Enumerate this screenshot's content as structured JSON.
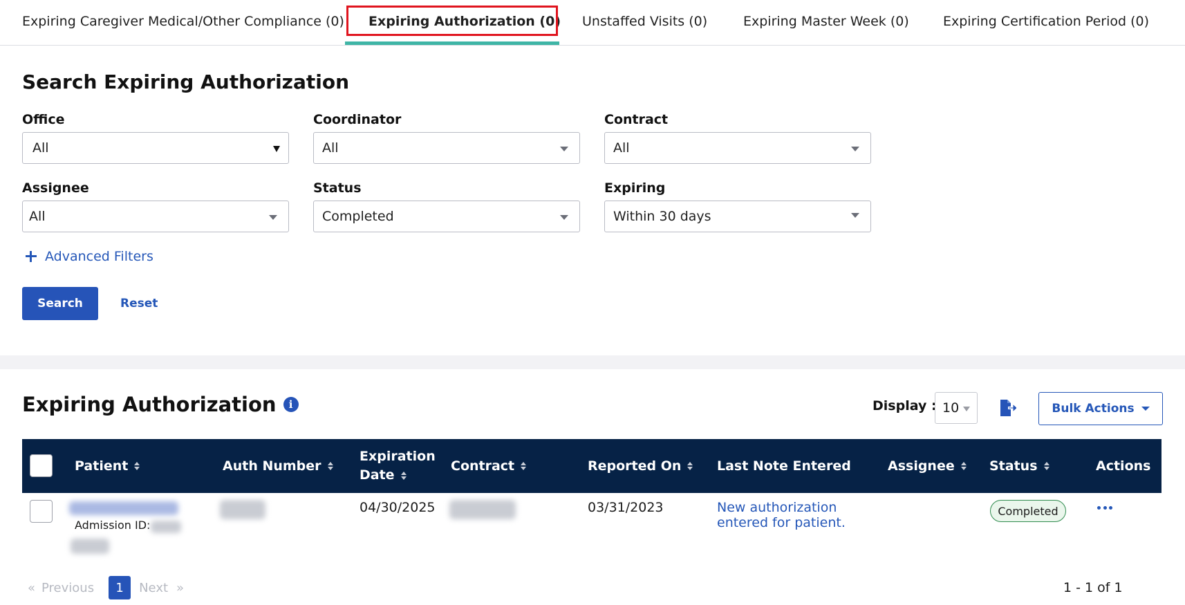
{
  "tabs": [
    {
      "label": "Expiring Caregiver Medical/Other Compliance (0)",
      "active": false
    },
    {
      "label": "Expiring Authorization (0)",
      "active": true
    },
    {
      "label": "Unstaffed Visits (0)",
      "active": false
    },
    {
      "label": "Expiring Master Week (0)",
      "active": false
    },
    {
      "label": "Expiring Certification Period (0)",
      "active": false
    }
  ],
  "search": {
    "title": "Search Expiring Authorization",
    "fields": {
      "office": {
        "label": "Office",
        "value": "All"
      },
      "coordinator": {
        "label": "Coordinator",
        "value": "All"
      },
      "contract": {
        "label": "Contract",
        "value": "All"
      },
      "assignee": {
        "label": "Assignee",
        "value": "All"
      },
      "status": {
        "label": "Status",
        "value": "Completed"
      },
      "expiring": {
        "label": "Expiring",
        "value": "Within 30 days"
      }
    },
    "advanced_filters": "Advanced Filters",
    "search_label": "Search",
    "reset_label": "Reset"
  },
  "results": {
    "title": "Expiring Authorization",
    "info_icon": "i",
    "display_label": "Display :",
    "display_value": "10",
    "bulk_actions": "Bulk Actions",
    "columns": {
      "patient": "Patient",
      "auth_number": "Auth Number",
      "expiration_date": "Expiration Date",
      "contract": "Contract",
      "reported_on": "Reported On",
      "last_note": "Last Note Entered",
      "assignee": "Assignee",
      "status": "Status",
      "actions": "Actions"
    },
    "rows": [
      {
        "admission_label": "Admission ID:",
        "expiration_date": "04/30/2025",
        "reported_on": "03/31/2023",
        "last_note": "New authorization entered for patient.",
        "status": "Completed"
      }
    ],
    "pagination": {
      "first": "«",
      "previous": "Previous",
      "current_page": "1",
      "next": "Next",
      "last": "»",
      "summary": "1 - 1 of 1"
    }
  },
  "colors": {
    "accent": "#2654b8",
    "header_bg": "#062246",
    "tab_underline": "#3fb5a6",
    "tab_highlight": "#e0141e",
    "status_completed": "#2e8b4d"
  }
}
